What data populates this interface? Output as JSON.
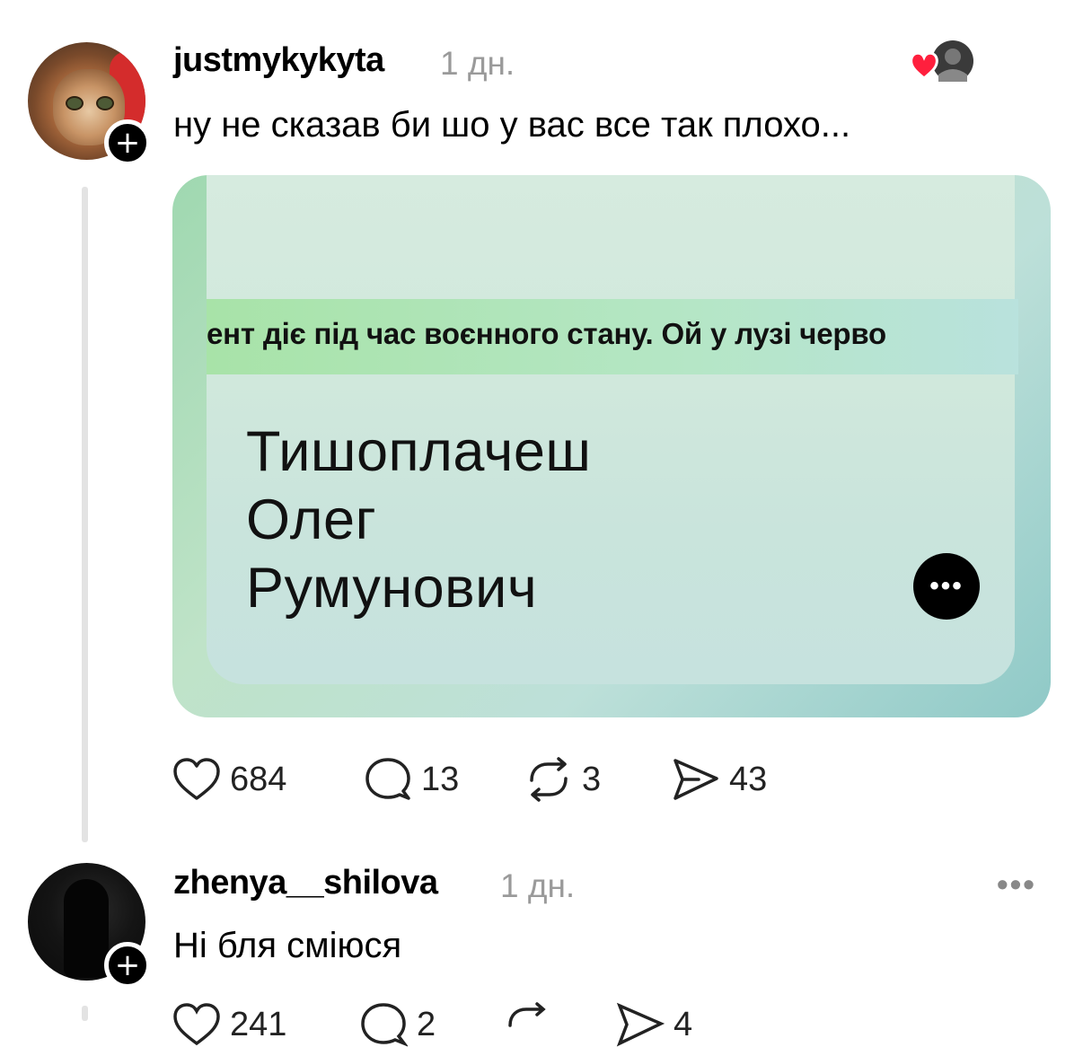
{
  "posts": [
    {
      "username": "justmykykyta",
      "time": "1 дн.",
      "text": "ну не сказав би шо у вас все так плохо...",
      "image": {
        "banner": "ент діє під час воєнного стану. Ой у лузі черво",
        "name_lines": [
          "Тишоплачеш",
          "Олег",
          "Румунович"
        ],
        "more_label": "•••"
      },
      "actions": {
        "likes": "684",
        "comments": "13",
        "reposts": "3",
        "shares": "43"
      },
      "follow_label": "+"
    },
    {
      "username": "zhenya__shilova",
      "time": "1 дн.",
      "text": "Ні бля сміюся",
      "menu_label": "•••",
      "follow_label": "+",
      "actions": {
        "likes": "241",
        "comments": "2",
        "reposts": "",
        "shares": "4"
      }
    }
  ],
  "colors": {
    "heart": "#ff2d55",
    "muted": "#9a9a9a",
    "accent": "#000000"
  },
  "icons": [
    "heart-icon",
    "comment-icon",
    "repost-icon",
    "share-icon",
    "more-icon",
    "plus-icon"
  ]
}
